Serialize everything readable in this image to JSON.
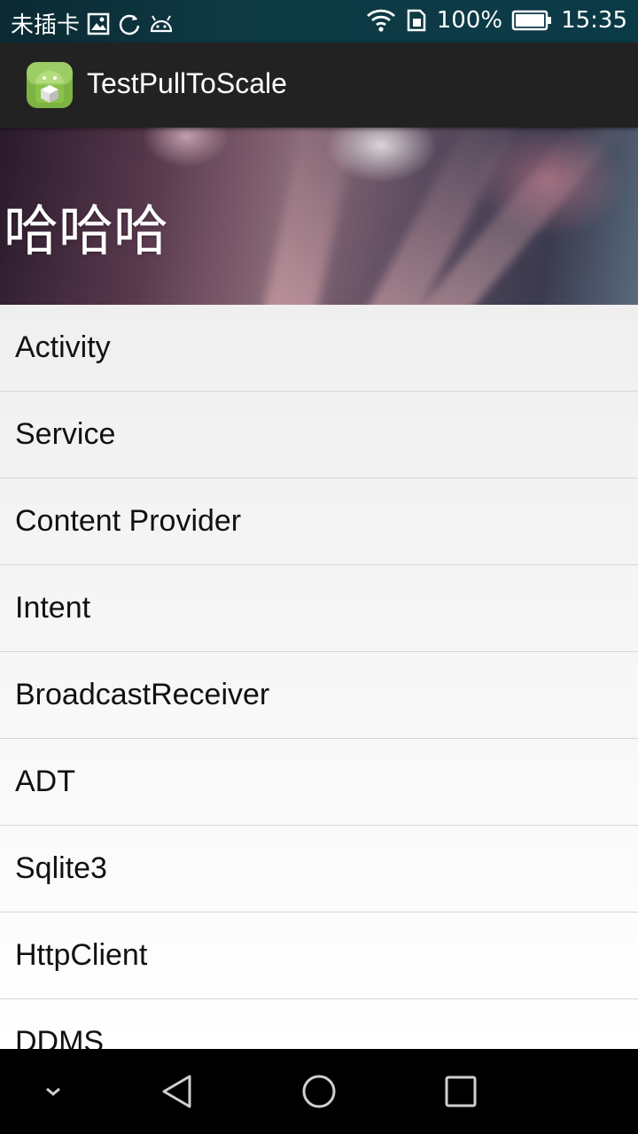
{
  "status_bar": {
    "carrier": "未插卡",
    "battery_percent": "100%",
    "time": "15:35",
    "icons": [
      "gallery-icon",
      "sync-icon",
      "android-icon",
      "wifi-icon",
      "sim-icon",
      "battery-icon"
    ]
  },
  "action_bar": {
    "title": "TestPullToScale",
    "icon": "android-app-icon"
  },
  "header": {
    "title": "哈哈哈"
  },
  "list": {
    "items": [
      "Activity",
      "Service",
      "Content Provider",
      "Intent",
      "BroadcastReceiver",
      "ADT",
      "Sqlite3",
      "HttpClient",
      "DDMS"
    ]
  },
  "nav_bar": {
    "buttons": [
      "hide-nav-icon",
      "back-icon",
      "home-icon",
      "recents-icon"
    ]
  },
  "colors": {
    "status_bar": "#0e3a44",
    "action_bar": "#222222",
    "nav_bar": "#000000",
    "app_icon_green": "#8bc34a"
  }
}
